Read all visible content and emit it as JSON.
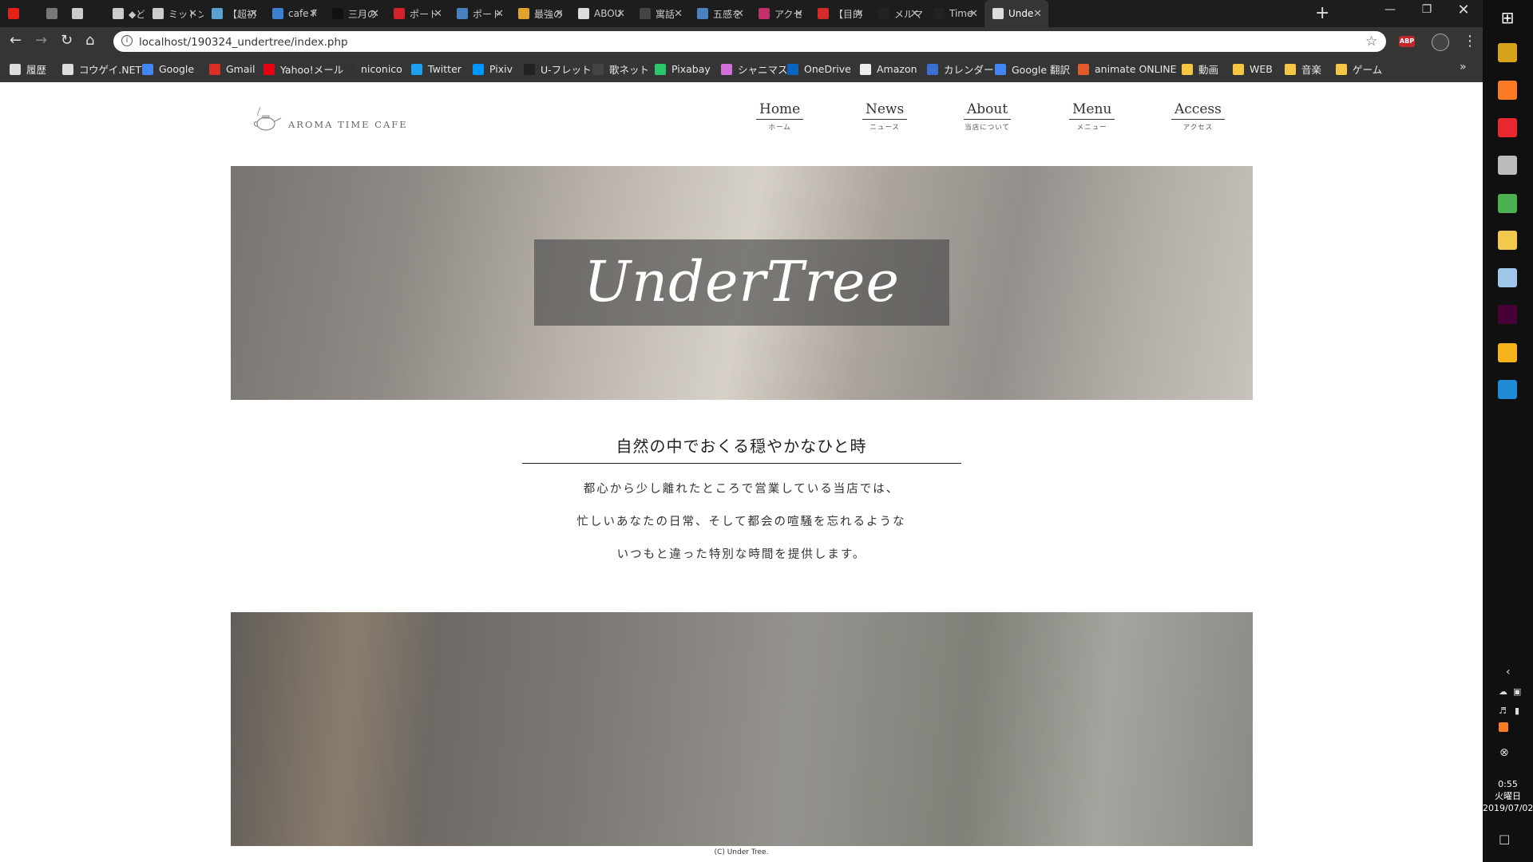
{
  "browser": {
    "tabs": [
      {
        "label": "",
        "color": "#e62117"
      },
      {
        "label": "",
        "color": "#777777"
      },
      {
        "label": "",
        "color": "#cccccc"
      },
      {
        "label": "◆どう",
        "color": "#cccccc"
      },
      {
        "label": "ミットン",
        "color": "#cccccc"
      },
      {
        "label": "【超初",
        "color": "#5aa0d0"
      },
      {
        "label": "cafe F",
        "color": "#3b7fd0"
      },
      {
        "label": "三月の",
        "color": "#111111"
      },
      {
        "label": "ポート",
        "color": "#d4212b"
      },
      {
        "label": "ポート",
        "color": "#4a7fc0"
      },
      {
        "label": "最強の",
        "color": "#e2a12a"
      },
      {
        "label": "ABOU",
        "color": "#dddddd"
      },
      {
        "label": "寓話",
        "color": "#444444"
      },
      {
        "label": "五感を",
        "color": "#4a7fc0"
      },
      {
        "label": "アクセ",
        "color": "#c0306a"
      },
      {
        "label": "【目的",
        "color": "#d42a2a"
      },
      {
        "label": "メルマ",
        "color": "#222222"
      },
      {
        "label": "Time",
        "color": "#222222"
      },
      {
        "label": "Unde",
        "color": "#dddddd",
        "active": true
      }
    ],
    "url": "localhost/190324_undertree/index.php",
    "bookmarks": [
      {
        "label": "履歴",
        "color": "#dddddd"
      },
      {
        "label": "コウゲイ.NET",
        "color": "#dddddd"
      },
      {
        "label": "Google",
        "color": "#4285f4"
      },
      {
        "label": "Gmail",
        "color": "#d93025"
      },
      {
        "label": "Yahoo!メール",
        "color": "#e60012"
      },
      {
        "label": "niconico",
        "color": "#333333"
      },
      {
        "label": "Twitter",
        "color": "#1da1f2"
      },
      {
        "label": "Pixiv",
        "color": "#0096fa"
      },
      {
        "label": "U-フレット",
        "color": "#222222"
      },
      {
        "label": "歌ネット",
        "color": "#444444"
      },
      {
        "label": "Pixabay",
        "color": "#2ec66d"
      },
      {
        "label": "シャニマス",
        "color": "#d36fd8"
      },
      {
        "label": "OneDrive",
        "color": "#0a64c2"
      },
      {
        "label": "Amazon",
        "color": "#eeeeee"
      },
      {
        "label": "カレンダー",
        "color": "#3b6fd1"
      },
      {
        "label": "Google 翻訳",
        "color": "#4285f4"
      },
      {
        "label": "animate ONLINE",
        "color": "#e05a2b"
      },
      {
        "label": "動画",
        "color": "#f4c542"
      },
      {
        "label": "WEB",
        "color": "#f4c542"
      },
      {
        "label": "音楽",
        "color": "#f4c542"
      },
      {
        "label": "ゲーム",
        "color": "#f4c542"
      }
    ],
    "abp_label": "ABP"
  },
  "site": {
    "logo_text": "AROMA TIME CAFE",
    "nav": [
      {
        "en": "Home",
        "ja": "ホーム"
      },
      {
        "en": "News",
        "ja": "ニュース"
      },
      {
        "en": "About",
        "ja": "当店について"
      },
      {
        "en": "Menu",
        "ja": "メニュー"
      },
      {
        "en": "Access",
        "ja": "アクセス"
      }
    ],
    "title": "UnderTree",
    "intro_heading": "自然の中でおくる穏やかなひと時",
    "intro_lines": [
      "都心から少し離れたところで営業している当店では、",
      "忙しいあなたの日常、そして都会の喧騒を忘れるような",
      "いつもと違った特別な時間を提供します。"
    ],
    "footer": "(C) Under Tree."
  },
  "taskbar": {
    "time": "0:55",
    "weekday": "火曜日",
    "date": "2019/07/02",
    "apps": [
      {
        "name": "ftp-app",
        "color": "#d6a11b"
      },
      {
        "name": "xampp-app",
        "color": "#fb7a24"
      },
      {
        "name": "xmind-app",
        "color": "#e8272f"
      },
      {
        "name": "disk-app",
        "color": "#bbbbbb"
      },
      {
        "name": "chrome-app",
        "color": "#4caf50"
      },
      {
        "name": "explorer-app",
        "color": "#f2c94c"
      },
      {
        "name": "notes-app",
        "color": "#9fc5e8"
      },
      {
        "name": "adobe-xd-app",
        "color": "#470137"
      },
      {
        "name": "chrome-canary-app",
        "color": "#f6b21a"
      },
      {
        "name": "vscode-app",
        "color": "#1e8ad6"
      }
    ]
  }
}
